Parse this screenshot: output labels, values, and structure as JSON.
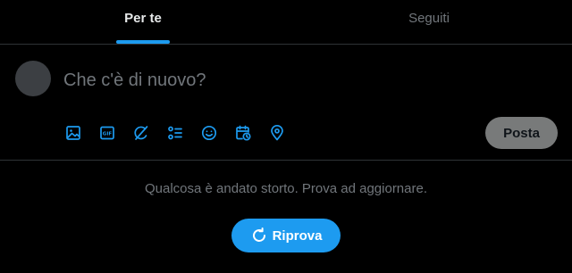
{
  "tabs": [
    {
      "label": "Per te",
      "active": true
    },
    {
      "label": "Seguiti",
      "active": false
    }
  ],
  "composer": {
    "placeholder": "Che c'è di nuovo?",
    "toolbar_icons": [
      "image-icon",
      "gif-icon",
      "grok-icon",
      "poll-icon",
      "emoji-icon",
      "schedule-icon",
      "location-icon"
    ],
    "post_label": "Posta"
  },
  "error": {
    "message": "Qualcosa è andato storto. Prova ad aggiornare.",
    "retry_label": "Riprova"
  },
  "colors": {
    "background": "#000000",
    "accent": "#1d9bf0",
    "divider": "#2f3336",
    "muted_text": "#71767b",
    "post_button_disabled": "#787a7a"
  }
}
